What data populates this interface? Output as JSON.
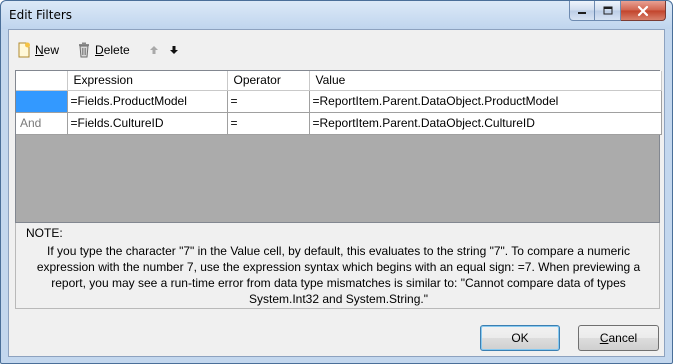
{
  "window": {
    "title": "Edit Filters"
  },
  "toolbar": {
    "new_label_prefix": "",
    "new_underline": "N",
    "new_rest": "ew",
    "delete_underline": "D",
    "delete_rest": "elete"
  },
  "grid": {
    "columns": [
      "",
      "Expression",
      "Operator",
      "Value"
    ],
    "rows": [
      {
        "conjunction": "",
        "expression": "=Fields.ProductModel",
        "operator": "=",
        "value": "=ReportItem.Parent.DataObject.ProductModel"
      },
      {
        "conjunction": "And",
        "expression": "=Fields.CultureID",
        "operator": "=",
        "value": "=ReportItem.Parent.DataObject.CultureID"
      }
    ]
  },
  "note": {
    "title": "NOTE:",
    "text": "If you type the character \"7\" in the Value cell, by default, this evaluates to the string \"7\". To compare a numeric expression with the number 7, use the expression syntax which begins with an equal sign: =7. When previewing a report, you may see a run-time error from data type mismatches is similar to: \"Cannot compare data of types System.Int32 and System.String.\""
  },
  "buttons": {
    "ok": "OK",
    "cancel_underline": "C",
    "cancel_rest": "ancel"
  },
  "colors": {
    "selection": "#3399ff",
    "grid_background": "#ababab"
  },
  "icons": [
    "new-document-icon",
    "delete-trash-icon",
    "move-up-icon",
    "move-down-icon",
    "minimize-icon",
    "maximize-icon",
    "close-icon"
  ]
}
